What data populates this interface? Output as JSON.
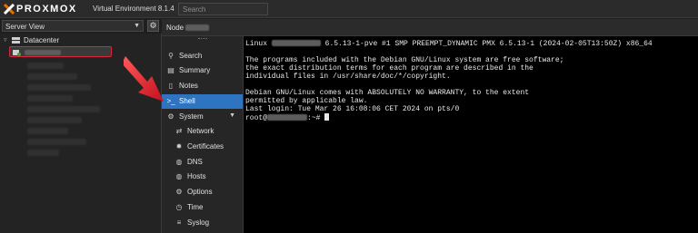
{
  "topbar": {
    "logo_text": "PROXMOX",
    "product": "Virtual Environment 8.1.4",
    "search_placeholder": "Search"
  },
  "tree_toolbar": {
    "view_label": "Server View"
  },
  "tree": {
    "datacenter_label": "Datacenter"
  },
  "node_header": {
    "label": "Node"
  },
  "nav": {
    "items": [
      {
        "label": "Search",
        "icon": "search-icon"
      },
      {
        "label": "Summary",
        "icon": "summary-icon"
      },
      {
        "label": "Notes",
        "icon": "notes-icon"
      },
      {
        "label": "Shell",
        "icon": "terminal-icon"
      },
      {
        "label": "System",
        "icon": "gear-icon"
      },
      {
        "label": "Network",
        "icon": "network-icon"
      },
      {
        "label": "Certificates",
        "icon": "certificate-icon"
      },
      {
        "label": "DNS",
        "icon": "globe-icon"
      },
      {
        "label": "Hosts",
        "icon": "globe-icon"
      },
      {
        "label": "Options",
        "icon": "gear-icon"
      },
      {
        "label": "Time",
        "icon": "clock-icon"
      },
      {
        "label": "Syslog",
        "icon": "list-icon"
      }
    ]
  },
  "terminal": {
    "line1_prefix": "Linux",
    "line1_rest": "6.5.13-1-pve #1 SMP PREEMPT_DYNAMIC PMX 6.5.13-1 (2024-02-05T13:50Z) x86_64",
    "line2": "The programs included with the Debian GNU/Linux system are free software;",
    "line3": "the exact distribution terms for each program are described in the",
    "line4": "individual files in /usr/share/doc/*/copyright.",
    "line5": "Debian GNU/Linux comes with ABSOLUTELY NO WARRANTY, to the extent",
    "line6": "permitted by applicable law.",
    "line7": "Last login: Tue Mar 26 16:08:06 CET 2024 on pts/0",
    "prompt_user": "root@",
    "prompt_suffix": ":~#"
  },
  "colors": {
    "accent": "#2f74c0",
    "highlight_red": "#d9263a",
    "logo_orange": "#e57000"
  }
}
